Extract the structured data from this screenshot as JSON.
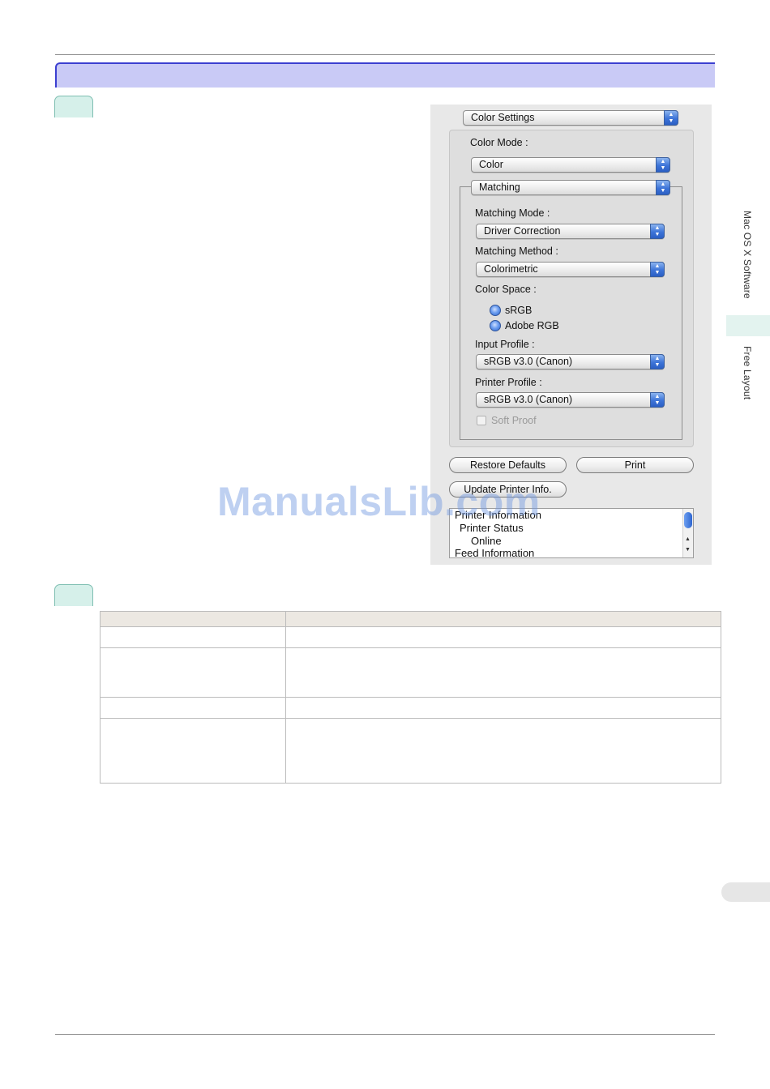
{
  "dialog": {
    "color_settings_menu": "Color Settings",
    "color_mode_label": "Color Mode :",
    "color_mode_value": "Color",
    "matching_menu": "Matching",
    "matching_mode_label": "Matching Mode :",
    "matching_mode_value": "Driver Correction",
    "matching_method_label": "Matching Method :",
    "matching_method_value": "Colorimetric",
    "color_space_label": "Color Space :",
    "color_space_options": [
      "sRGB",
      "Adobe RGB"
    ],
    "input_profile_label": "Input Profile :",
    "input_profile_value": "sRGB v3.0 (Canon)",
    "printer_profile_label": "Printer Profile :",
    "printer_profile_value": "sRGB v3.0 (Canon)",
    "soft_proof_label": "Soft Proof",
    "restore_defaults_button": "Restore Defaults",
    "print_button": "Print",
    "update_printer_info_button": "Update Printer Info.",
    "printer_info_lines": [
      "Printer Information",
      "Printer Status",
      "Online",
      "Feed Information"
    ]
  },
  "side_tabs": {
    "mac_os_x_software": "Mac OS X Software",
    "free_layout": "Free Layout"
  },
  "watermark": "ManualsLib.com",
  "colors": {
    "section_bar": "#c9caf6",
    "section_border": "#3b3fd0",
    "step_tab": "#d6f0ea",
    "side_tab": "#e3f3ef",
    "table_header": "#ece8e2"
  }
}
